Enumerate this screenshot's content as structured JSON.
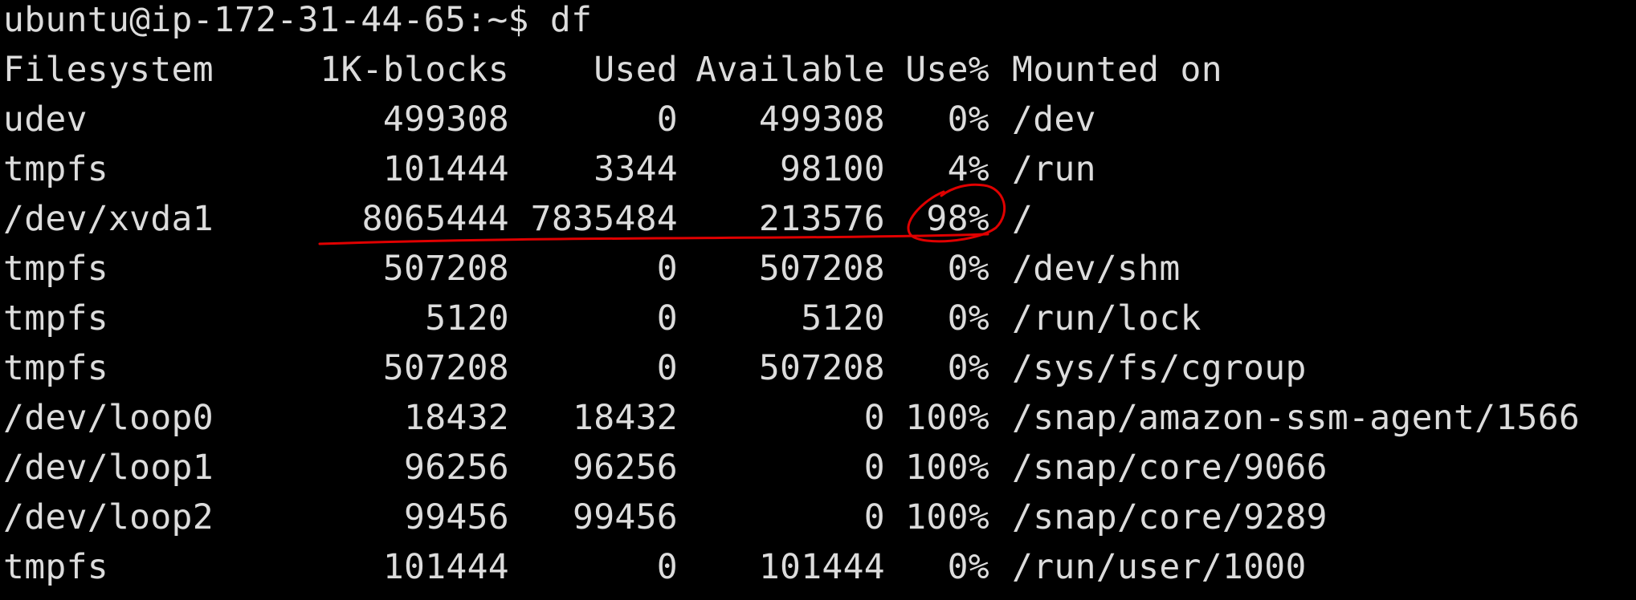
{
  "terminal": {
    "prompt": "ubuntu@ip-172-31-44-65:~$",
    "command": "df",
    "headers": {
      "filesystem": "Filesystem",
      "blocks": "1K-blocks",
      "used": "Used",
      "available": "Available",
      "use_pct": "Use%",
      "mounted": "Mounted on"
    },
    "rows": [
      {
        "filesystem": "udev",
        "blocks": "499308",
        "used": "0",
        "available": "499308",
        "use_pct": "0%",
        "mounted": "/dev"
      },
      {
        "filesystem": "tmpfs",
        "blocks": "101444",
        "used": "3344",
        "available": "98100",
        "use_pct": "4%",
        "mounted": "/run"
      },
      {
        "filesystem": "/dev/xvda1",
        "blocks": "8065444",
        "used": "7835484",
        "available": "213576",
        "use_pct": "98%",
        "mounted": "/"
      },
      {
        "filesystem": "tmpfs",
        "blocks": "507208",
        "used": "0",
        "available": "507208",
        "use_pct": "0%",
        "mounted": "/dev/shm"
      },
      {
        "filesystem": "tmpfs",
        "blocks": "5120",
        "used": "0",
        "available": "5120",
        "use_pct": "0%",
        "mounted": "/run/lock"
      },
      {
        "filesystem": "tmpfs",
        "blocks": "507208",
        "used": "0",
        "available": "507208",
        "use_pct": "0%",
        "mounted": "/sys/fs/cgroup"
      },
      {
        "filesystem": "/dev/loop0",
        "blocks": "18432",
        "used": "18432",
        "available": "0",
        "use_pct": "100%",
        "mounted": "/snap/amazon-ssm-agent/1566"
      },
      {
        "filesystem": "/dev/loop1",
        "blocks": "96256",
        "used": "96256",
        "available": "0",
        "use_pct": "100%",
        "mounted": "/snap/core/9066"
      },
      {
        "filesystem": "/dev/loop2",
        "blocks": "99456",
        "used": "99456",
        "available": "0",
        "use_pct": "100%",
        "mounted": "/snap/core/9289"
      },
      {
        "filesystem": "tmpfs",
        "blocks": "101444",
        "used": "0",
        "available": "101444",
        "use_pct": "0%",
        "mounted": "/run/user/1000"
      }
    ]
  },
  "colors": {
    "background": "#000000",
    "foreground": "#dcdcdc",
    "annotation": "#e00000"
  }
}
